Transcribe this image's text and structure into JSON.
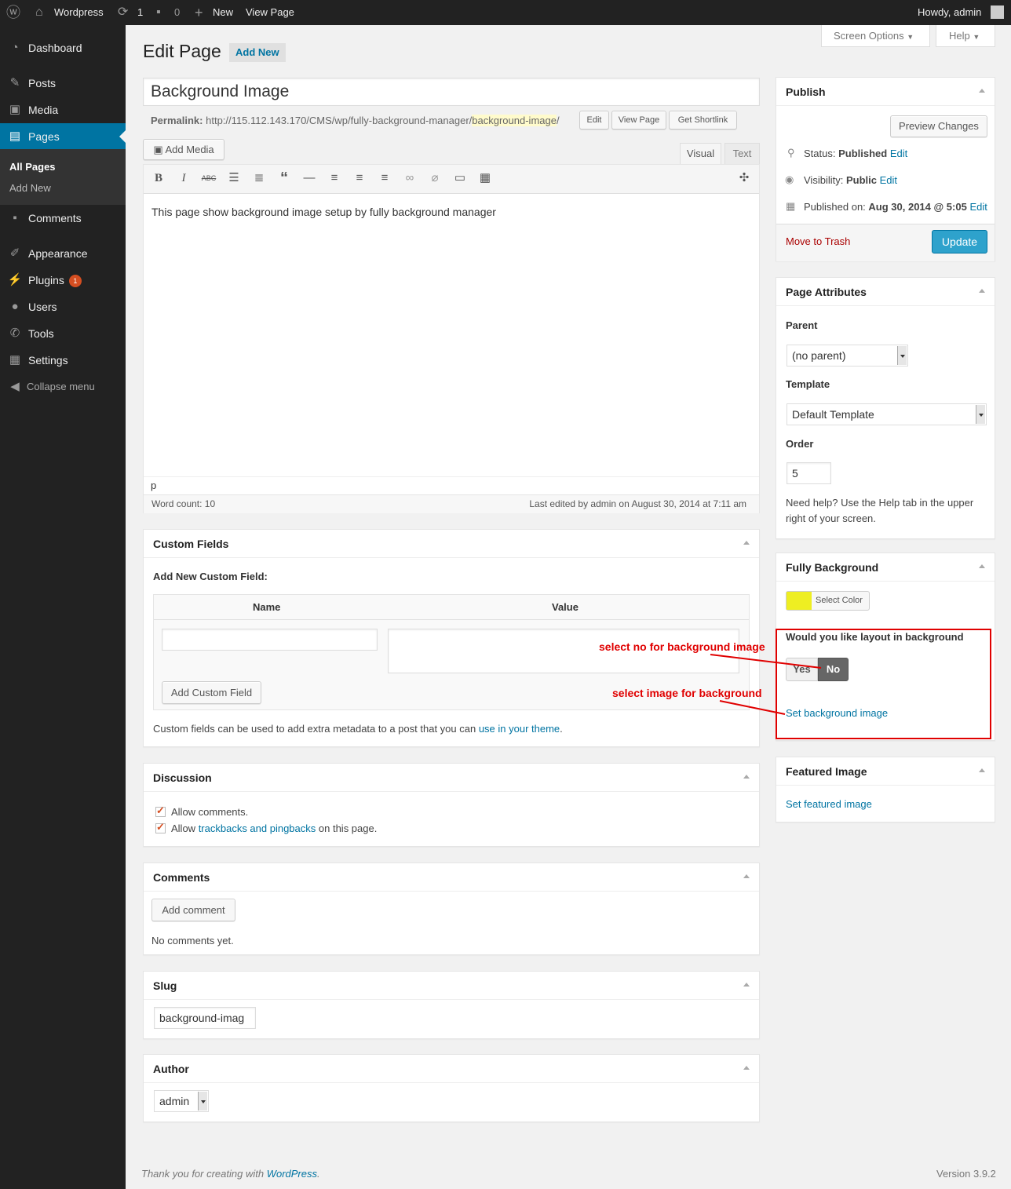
{
  "adminbar": {
    "site": "Wordpress",
    "updates": "1",
    "comments": "0",
    "new": "New",
    "view_page": "View Page",
    "howdy": "Howdy, admin"
  },
  "sidebar": {
    "items": [
      {
        "label": "Dashboard",
        "icon": "dashboard-icon"
      },
      {
        "label": "Posts",
        "icon": "pushpin-icon"
      },
      {
        "label": "Media",
        "icon": "media-icon"
      },
      {
        "label": "Pages",
        "icon": "pages-icon"
      },
      {
        "label": "Comments",
        "icon": "comment-icon"
      },
      {
        "label": "Appearance",
        "icon": "brush-icon"
      },
      {
        "label": "Plugins",
        "icon": "plug-icon",
        "badge": "1"
      },
      {
        "label": "Users",
        "icon": "users-icon"
      },
      {
        "label": "Tools",
        "icon": "wrench-icon"
      },
      {
        "label": "Settings",
        "icon": "settings-icon"
      }
    ],
    "submenu": [
      "All Pages",
      "Add New"
    ],
    "collapse": "Collapse menu"
  },
  "header": {
    "title": "Edit Page",
    "add_new": "Add New",
    "screen_options": "Screen Options",
    "help": "Help"
  },
  "editor": {
    "post_title": "Background Image",
    "permalink_label": "Permalink:",
    "permalink_base": "http://115.112.143.170/CMS/wp/fully-background-manager/",
    "permalink_slug": "background-image",
    "permalink_tail": "/",
    "edit": "Edit",
    "view_page": "View Page",
    "get_shortlink": "Get Shortlink",
    "add_media": "Add Media",
    "tab_visual": "Visual",
    "tab_text": "Text",
    "content": "This page show background image setup by fully background manager",
    "path": "p",
    "word_count": "Word count: 10",
    "last_edited": "Last edited by admin on August 30, 2014 at 7:11 am"
  },
  "custom_fields": {
    "title": "Custom Fields",
    "add_new": "Add New Custom Field:",
    "col_name": "Name",
    "col_value": "Value",
    "add_button": "Add Custom Field",
    "note_pre": "Custom fields can be used to add extra metadata to a post that you can ",
    "note_link": "use in your theme",
    "note_post": "."
  },
  "discussion": {
    "title": "Discussion",
    "allow_comments": "Allow comments.",
    "allow_pre": "Allow ",
    "trackbacks_link": "trackbacks and pingbacks",
    "allow_post": " on this page."
  },
  "comments": {
    "title": "Comments",
    "add_comment": "Add comment",
    "none": "No comments yet."
  },
  "slug": {
    "title": "Slug",
    "value": "background-imag"
  },
  "author": {
    "title": "Author",
    "value": "admin"
  },
  "publish": {
    "title": "Publish",
    "preview": "Preview Changes",
    "status_label": "Status:",
    "status_value": "Published",
    "visibility_label": "Visibility:",
    "visibility_value": "Public",
    "published_label": "Published on:",
    "published_value": "Aug 30, 2014 @ 5:05",
    "edit": "Edit",
    "trash": "Move to Trash",
    "update": "Update"
  },
  "page_attributes": {
    "title": "Page Attributes",
    "parent_label": "Parent",
    "parent_value": "(no parent)",
    "template_label": "Template",
    "template_value": "Default Template",
    "order_label": "Order",
    "order_value": "5",
    "help_line1": "Need help? Use the Help tab in the upper",
    "help_line2": "right of your screen."
  },
  "fully_background": {
    "title": "Fully Background",
    "select_color": "Select Color",
    "swatch_color": "#eeee22",
    "question": "Would you like layout in background",
    "yes": "Yes",
    "no": "No",
    "set_bg": "Set background image"
  },
  "annotations": {
    "no": "select no for background image",
    "image": "select image for background"
  },
  "featured": {
    "title": "Featured Image",
    "set": "Set featured image"
  },
  "footer": {
    "thanks_pre": "Thank you for creating with ",
    "thanks_link": "WordPress",
    "thanks_post": ".",
    "version": "Version 3.9.2"
  }
}
